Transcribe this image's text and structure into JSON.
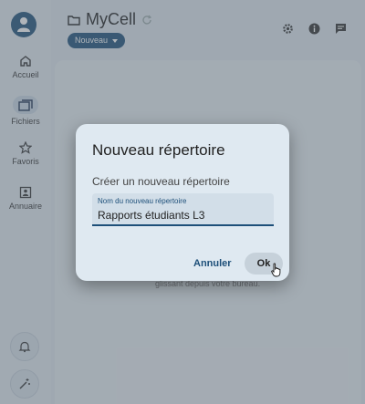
{
  "sidebar": {
    "items": [
      {
        "label": "Accueil",
        "icon": "home-icon"
      },
      {
        "label": "Fichiers",
        "icon": "folder-icon"
      },
      {
        "label": "Favoris",
        "icon": "star-icon"
      },
      {
        "label": "Annuaire",
        "icon": "contact-icon"
      }
    ],
    "active": "Fichiers"
  },
  "header": {
    "title": "MyCell",
    "new_button_label": "Nouveau"
  },
  "main": {
    "hint_text": "glissant depuis votre bureau."
  },
  "dialog": {
    "title": "Nouveau répertoire",
    "subtitle": "Créer un nouveau répertoire",
    "field_label": "Nom du nouveau répertoire",
    "field_value": "Rapports étudiants L3",
    "cancel_label": "Annuler",
    "ok_label": "Ok"
  },
  "colors": {
    "primary": "#1d4f79",
    "overlay": "#5a646e"
  }
}
